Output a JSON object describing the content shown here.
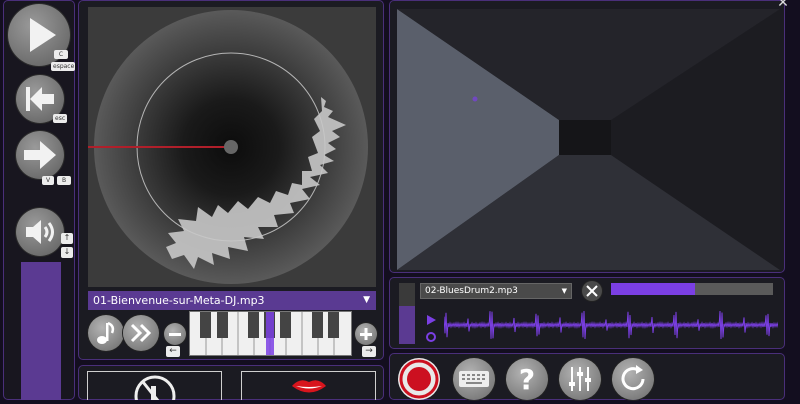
{
  "transport": {
    "play_keys": [
      "C",
      "espace"
    ],
    "prev_key": "esc",
    "next_keys": [
      "V",
      "B"
    ]
  },
  "deck": {
    "track_name": "01-Bienvenue-sur-Meta-DJ.mp3",
    "minus_key": "←",
    "plus_key": "→"
  },
  "sampler": {
    "track_name": "02-BluesDrum2.mp3",
    "progress": 0.52
  },
  "icons": {
    "play": "play-icon",
    "prev": "skip-back-icon",
    "next": "arrow-right-icon",
    "volume": "speaker-icon",
    "note": "music-note-icon",
    "ff": "fast-forward-icon",
    "record": "record-icon",
    "keyboard": "keyboard-icon",
    "help": "help-icon",
    "mixer": "mixer-sliders-icon",
    "reset": "reset-icon"
  },
  "colors": {
    "accent": "#7b3fe4",
    "panel_border": "#4a2f7a",
    "needle": "#b01f2a",
    "record": "#cc1020"
  }
}
